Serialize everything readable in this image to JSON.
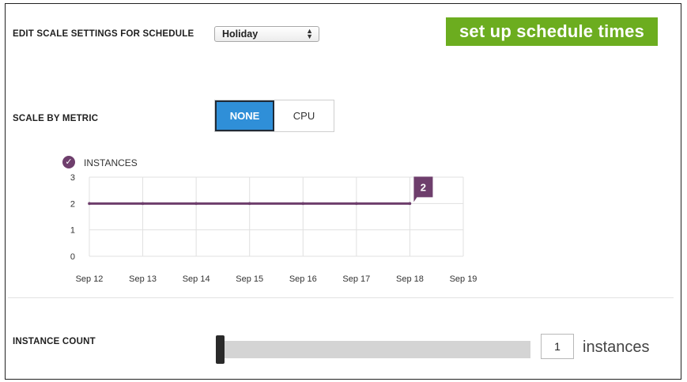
{
  "schedule": {
    "label": "EDIT SCALE SETTINGS FOR SCHEDULE",
    "selected": "Holiday"
  },
  "setup_button": {
    "label": "set up schedule times"
  },
  "metric": {
    "label": "SCALE BY METRIC",
    "options": [
      "NONE",
      "CPU"
    ],
    "selected": "NONE"
  },
  "colors": {
    "accent_green": "#6cad1f",
    "accent_blue": "#2f8fd8",
    "series_purple": "#6e3e6c"
  },
  "chart_data": {
    "type": "line",
    "series": [
      {
        "name": "INSTANCES",
        "values": [
          2,
          2,
          2,
          2,
          2,
          2,
          2
        ]
      }
    ],
    "categories": [
      "Sep 12",
      "Sep 13",
      "Sep 14",
      "Sep 15",
      "Sep 16",
      "Sep 17",
      "Sep 18",
      "Sep 19"
    ],
    "yticks": [
      0,
      1,
      2,
      3
    ],
    "ylim": [
      0,
      3
    ],
    "end_label": "2",
    "grid": true
  },
  "instance_count": {
    "label": "INSTANCE COUNT",
    "value": "1",
    "unit": "instances"
  }
}
